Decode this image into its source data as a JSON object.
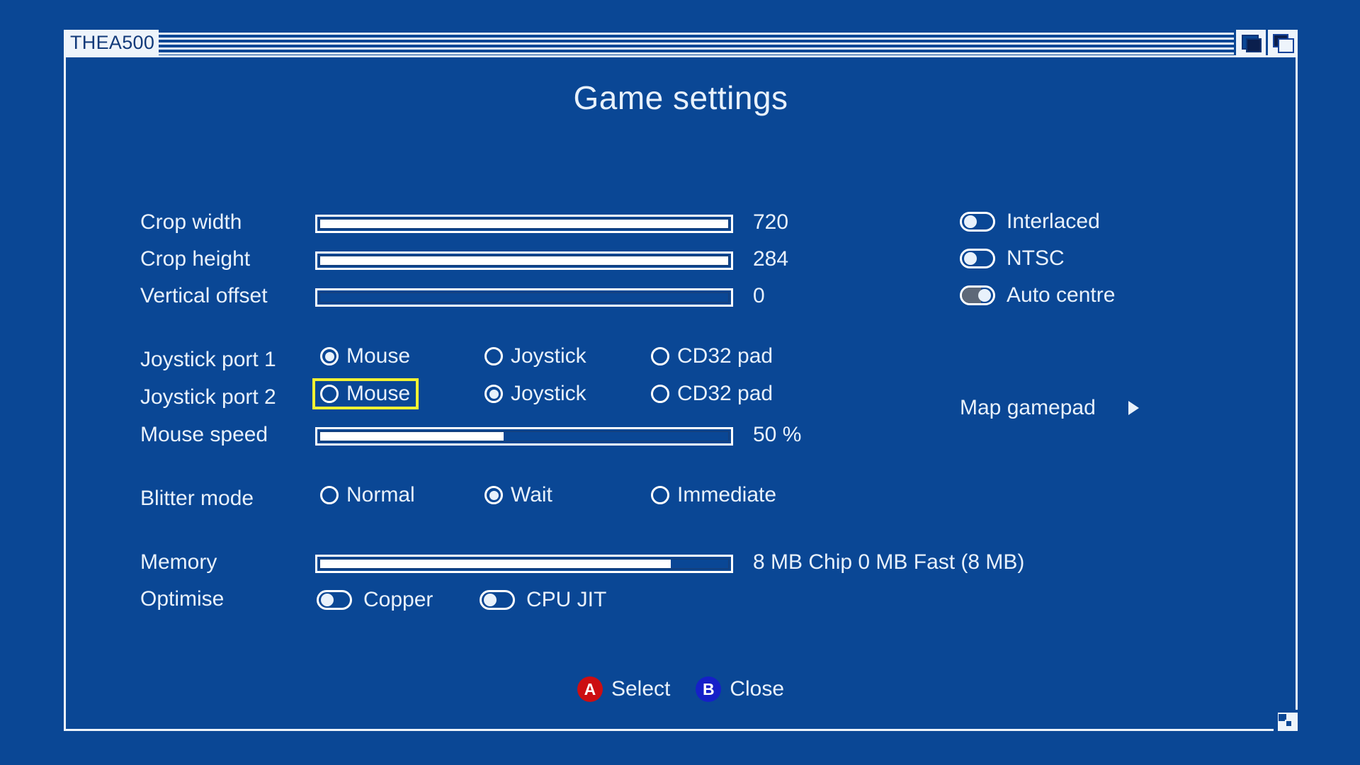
{
  "theme": {
    "background": "#0a4795",
    "window_bg": "#0a4795",
    "border": "#eef4fb",
    "text": "#e8f1fb",
    "title_text": "#123a7a",
    "focus_highlight": "#f2f233",
    "toggle_on_track": "#5d6878",
    "badge_a": "#cc0e12",
    "badge_b": "#1520c8"
  },
  "window": {
    "title": "THEA500",
    "gadgets": {
      "depth": "depth-gadget",
      "zoom": "zoom-gadget",
      "size": "size-gadget"
    }
  },
  "page": {
    "title": "Game settings"
  },
  "sliders": [
    {
      "label": "Crop width",
      "value": "720",
      "fill_pct": 100
    },
    {
      "label": "Crop height",
      "value": "284",
      "fill_pct": 100
    },
    {
      "label": "Vertical offset",
      "value": "0",
      "fill_pct": 0
    },
    {
      "label": "Mouse speed",
      "value": "50 %",
      "fill_pct": 45
    },
    {
      "label": "Memory",
      "value": "8 MB Chip  0 MB Fast  (8 MB)",
      "fill_pct": 86
    }
  ],
  "display_toggles": [
    {
      "label": "Interlaced",
      "on": false
    },
    {
      "label": "NTSC",
      "on": false
    },
    {
      "label": "Auto centre",
      "on": true
    }
  ],
  "joystick_port_1": {
    "label": "Joystick port 1",
    "options": [
      {
        "label": "Mouse",
        "selected": true,
        "focused": false
      },
      {
        "label": "Joystick",
        "selected": false,
        "focused": false
      },
      {
        "label": "CD32 pad",
        "selected": false,
        "focused": false
      }
    ]
  },
  "joystick_port_2": {
    "label": "Joystick port 2",
    "options": [
      {
        "label": "Mouse",
        "selected": false,
        "focused": true
      },
      {
        "label": "Joystick",
        "selected": true,
        "focused": false
      },
      {
        "label": "CD32 pad",
        "selected": false,
        "focused": false
      }
    ]
  },
  "blitter_mode": {
    "label": "Blitter mode",
    "options": [
      {
        "label": "Normal",
        "selected": false,
        "focused": false
      },
      {
        "label": "Wait",
        "selected": true,
        "focused": false
      },
      {
        "label": "Immediate",
        "selected": false,
        "focused": false
      }
    ]
  },
  "optimise": {
    "label": "Optimise",
    "toggles": [
      {
        "label": "Copper",
        "on": false
      },
      {
        "label": "CPU JIT",
        "on": false
      }
    ]
  },
  "map_gamepad": {
    "label": "Map gamepad",
    "arrow": "chevron-right-icon"
  },
  "hints": [
    {
      "button": "A",
      "label": "Select",
      "color": "#cc0e12"
    },
    {
      "button": "B",
      "label": "Close",
      "color": "#1520c8"
    }
  ]
}
